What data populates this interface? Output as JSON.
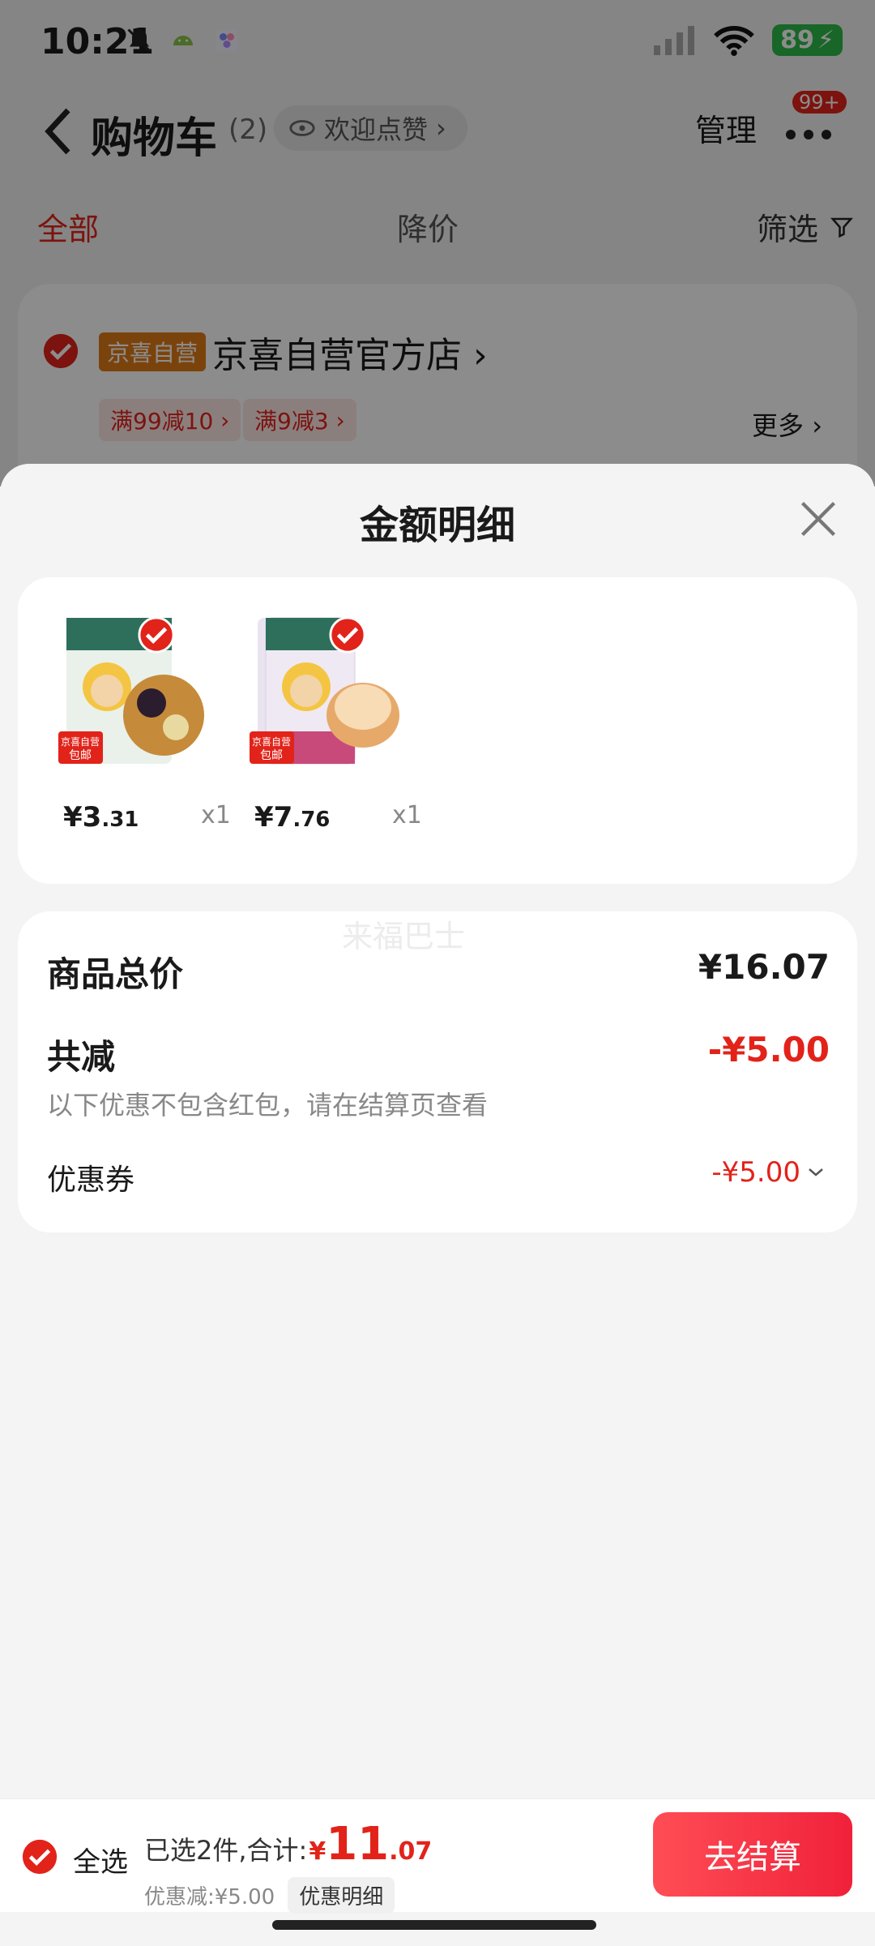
{
  "status_bar": {
    "time": "10:21",
    "battery": "89"
  },
  "nav": {
    "title": "购物车",
    "count": "(2)",
    "welcome": "欢迎点赞",
    "manage": "管理",
    "badge": "99+"
  },
  "tabs": {
    "all": "全部",
    "price_drop": "降价",
    "filter": "筛选"
  },
  "shop": {
    "tag": "京喜自营",
    "name": "京喜自营官方店",
    "promos": [
      "满99减10",
      "满9减3"
    ],
    "more": "更多"
  },
  "sheet": {
    "title": "金额明细",
    "items": [
      {
        "price_yen": "¥3",
        "price_cents": ".31",
        "qty": "x1",
        "img_tag": "包邮",
        "img_brand": "京喜自营"
      },
      {
        "price_yen": "¥7",
        "price_cents": ".76",
        "qty": "x1",
        "img_tag": "包邮",
        "img_brand": "京喜自营"
      }
    ],
    "watermark": "来福巴士",
    "goods_total_label": "商品总价",
    "goods_total_value": "¥16.07",
    "total_discount_label": "共减",
    "total_discount_value": "-¥5.00",
    "note": "以下优惠不包含红包，请在结算页查看",
    "coupon_label": "优惠券",
    "coupon_value": "-¥5.00"
  },
  "bottom": {
    "select_all": "全选",
    "selected": "已选2件,合计:",
    "currency": "¥",
    "total_int": "11",
    "total_dec": ".07",
    "discount": "优惠减:¥5.00",
    "detail": "优惠明细",
    "checkout": "去结算"
  },
  "colors": {
    "accent": "#e2231a",
    "tag_orange": "#e07a17",
    "battery_green": "#2dbb4a"
  }
}
